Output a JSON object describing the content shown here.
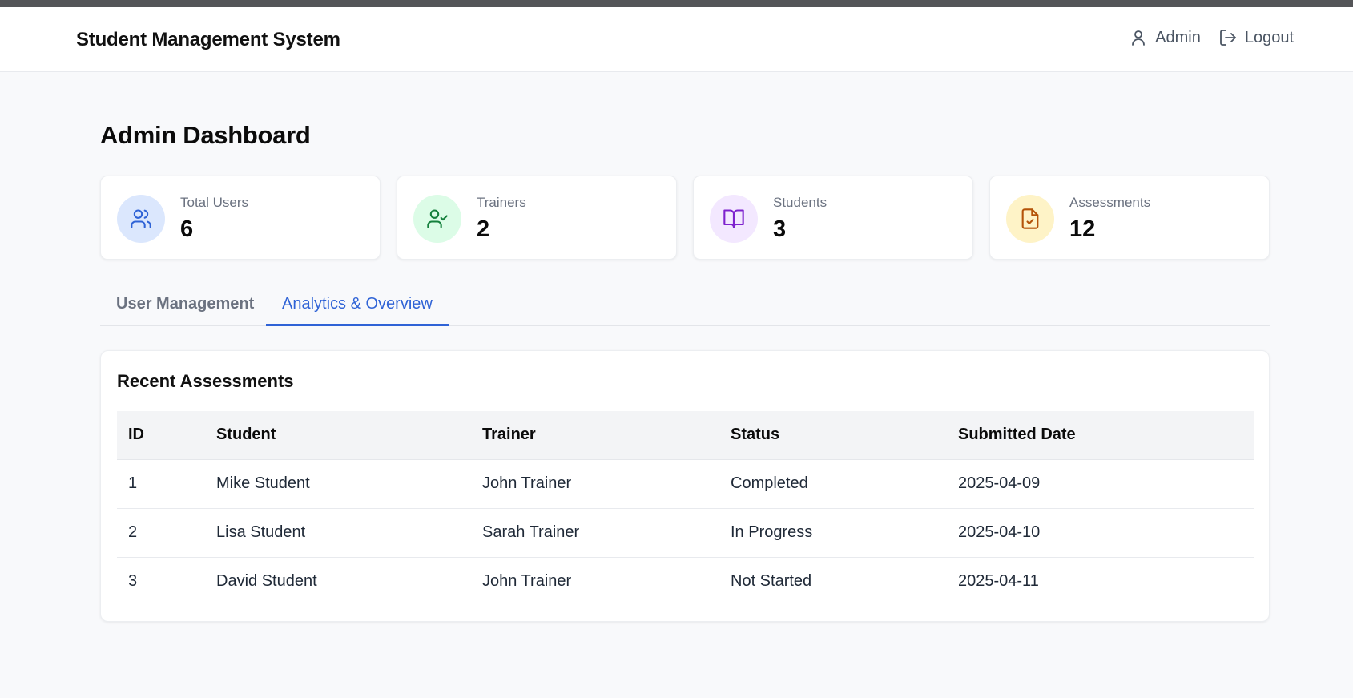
{
  "header": {
    "app_title": "Student Management System",
    "user_label": "Admin",
    "logout_label": "Logout"
  },
  "page": {
    "title": "Admin Dashboard"
  },
  "stats": [
    {
      "label": "Total Users",
      "value": "6",
      "icon": "users-icon",
      "icon_color": "#2f63d6",
      "icon_bg": "#dbe7fd"
    },
    {
      "label": "Trainers",
      "value": "2",
      "icon": "user-check-icon",
      "icon_color": "#15803d",
      "icon_bg": "#dcfce7"
    },
    {
      "label": "Students",
      "value": "3",
      "icon": "book-open-icon",
      "icon_color": "#7e22ce",
      "icon_bg": "#f3e8ff"
    },
    {
      "label": "Assessments",
      "value": "12",
      "icon": "file-check-icon",
      "icon_color": "#b45309",
      "icon_bg": "#fef3c7"
    }
  ],
  "tabs": [
    {
      "label": "User Management",
      "active": false
    },
    {
      "label": "Analytics & Overview",
      "active": true
    }
  ],
  "recent_assessments": {
    "title": "Recent Assessments",
    "columns": [
      "ID",
      "Student",
      "Trainer",
      "Status",
      "Submitted Date"
    ],
    "rows": [
      [
        "1",
        "Mike Student",
        "John Trainer",
        "Completed",
        "2025-04-09"
      ],
      [
        "2",
        "Lisa Student",
        "Sarah Trainer",
        "In Progress",
        "2025-04-10"
      ],
      [
        "3",
        "David Student",
        "John Trainer",
        "Not Started",
        "2025-04-11"
      ]
    ]
  },
  "colors": {
    "accent": "#2f63d6",
    "page_bg": "#f8f9fb",
    "top_strip": "#545558"
  }
}
